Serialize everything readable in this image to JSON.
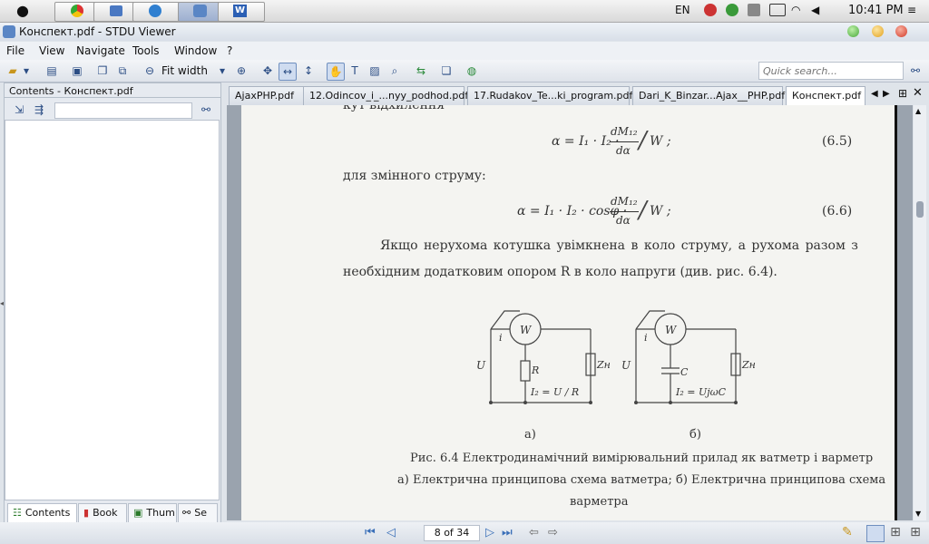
{
  "menubar": {
    "input_lang": "EN",
    "clock": "10:41 PM"
  },
  "window": {
    "title": "Конспект.pdf - STDU Viewer"
  },
  "menu": [
    "File",
    "View",
    "Navigate",
    "Tools",
    "Window",
    "?"
  ],
  "toolbar": {
    "zoom_mode": "Fit width",
    "quick_search_placeholder": "Quick search..."
  },
  "left_panel": {
    "title": "Contents - Конспект.pdf",
    "tabs": [
      "Contents",
      "Book",
      "Thum",
      "Se"
    ]
  },
  "doc_tabs": [
    "AjaxPHP.pdf",
    "12.Odincov_i_...nyy_podhod.pdf",
    "17.Rudakov_Te...ki_program.pdf",
    "Dari_K_Binzar...Ajax__PHP.pdf",
    "Конспект.pdf"
  ],
  "page": {
    "top_cut": "кут відхилення",
    "eq1_left": "α = I₁ · I₂ ·",
    "eq1_num": "dM₁₂",
    "eq1_den": "dα",
    "eq1_right": "W ;",
    "eq1_no": "(6.5)",
    "ac_text": "для змінного струму:",
    "eq2_left": "α = I₁ · I₂ · cosφ ·",
    "eq2_num": "dM₁₂",
    "eq2_den": "dα",
    "eq2_right": "W ;",
    "eq2_no": "(6.6)",
    "para1": "Якщо нерухома котушка увімкнена в коло струму, а рухома разом з",
    "para2": "необхідним додатковим опором  R  в коло напруги (див. рис. 6.4).",
    "fig_a": {
      "W": "W",
      "i": "i",
      "U": "U",
      "R": "R",
      "Zn": "Zн",
      "I2": "I₂ = U / R",
      "label": "а)"
    },
    "fig_b": {
      "W": "W",
      "i": "i",
      "U": "U",
      "C": "C",
      "Zn": "Zн",
      "I2": "I₂ = UjωC",
      "label": "б)"
    },
    "caption1": "Рис. 6.4 Електродинамічний вимірювальний прилад як ватметр і варметр",
    "caption2": "а) Електрична принципова схема ватметра; б) Електрична принципова схема",
    "caption3": "варметра"
  },
  "status": {
    "page_indicator": "8 of 34"
  }
}
